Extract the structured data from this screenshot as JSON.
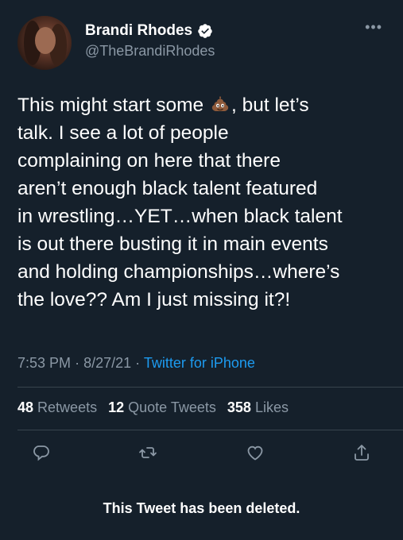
{
  "tweet": {
    "author": {
      "display_name": "Brandi Rhodes",
      "handle": "@TheBrandiRhodes",
      "verified": true
    },
    "text_part1": "This might start some ",
    "text_emoji": "pile-of-poo-emoji",
    "text_part2": ", but let’s\ntalk. I see a lot of people\ncomplaining on here that there\naren’t enough black talent featured\nin wrestling…YET…when black talent\nis out there busting it in main events\nand holding championships…where’s\nthe love?? Am I just missing it?!",
    "time": "7:53 PM",
    "date": "8/27/21",
    "separator": "·",
    "source": "Twitter for iPhone"
  },
  "stats": {
    "retweets_count": "48",
    "retweets_label": "Retweets",
    "quote_tweets_count": "12",
    "quote_tweets_label": "Quote Tweets",
    "likes_count": "358",
    "likes_label": "Likes"
  },
  "actions": {
    "reply_icon": "reply-icon",
    "retweet_icon": "retweet-icon",
    "like_icon": "heart-icon",
    "share_icon": "share-icon"
  },
  "notice": "This Tweet has been deleted.",
  "colors": {
    "background": "#15202b",
    "text": "#ffffff",
    "secondary_text": "#8b98a5",
    "accent": "#1d9bf0",
    "divider": "#38444d"
  }
}
